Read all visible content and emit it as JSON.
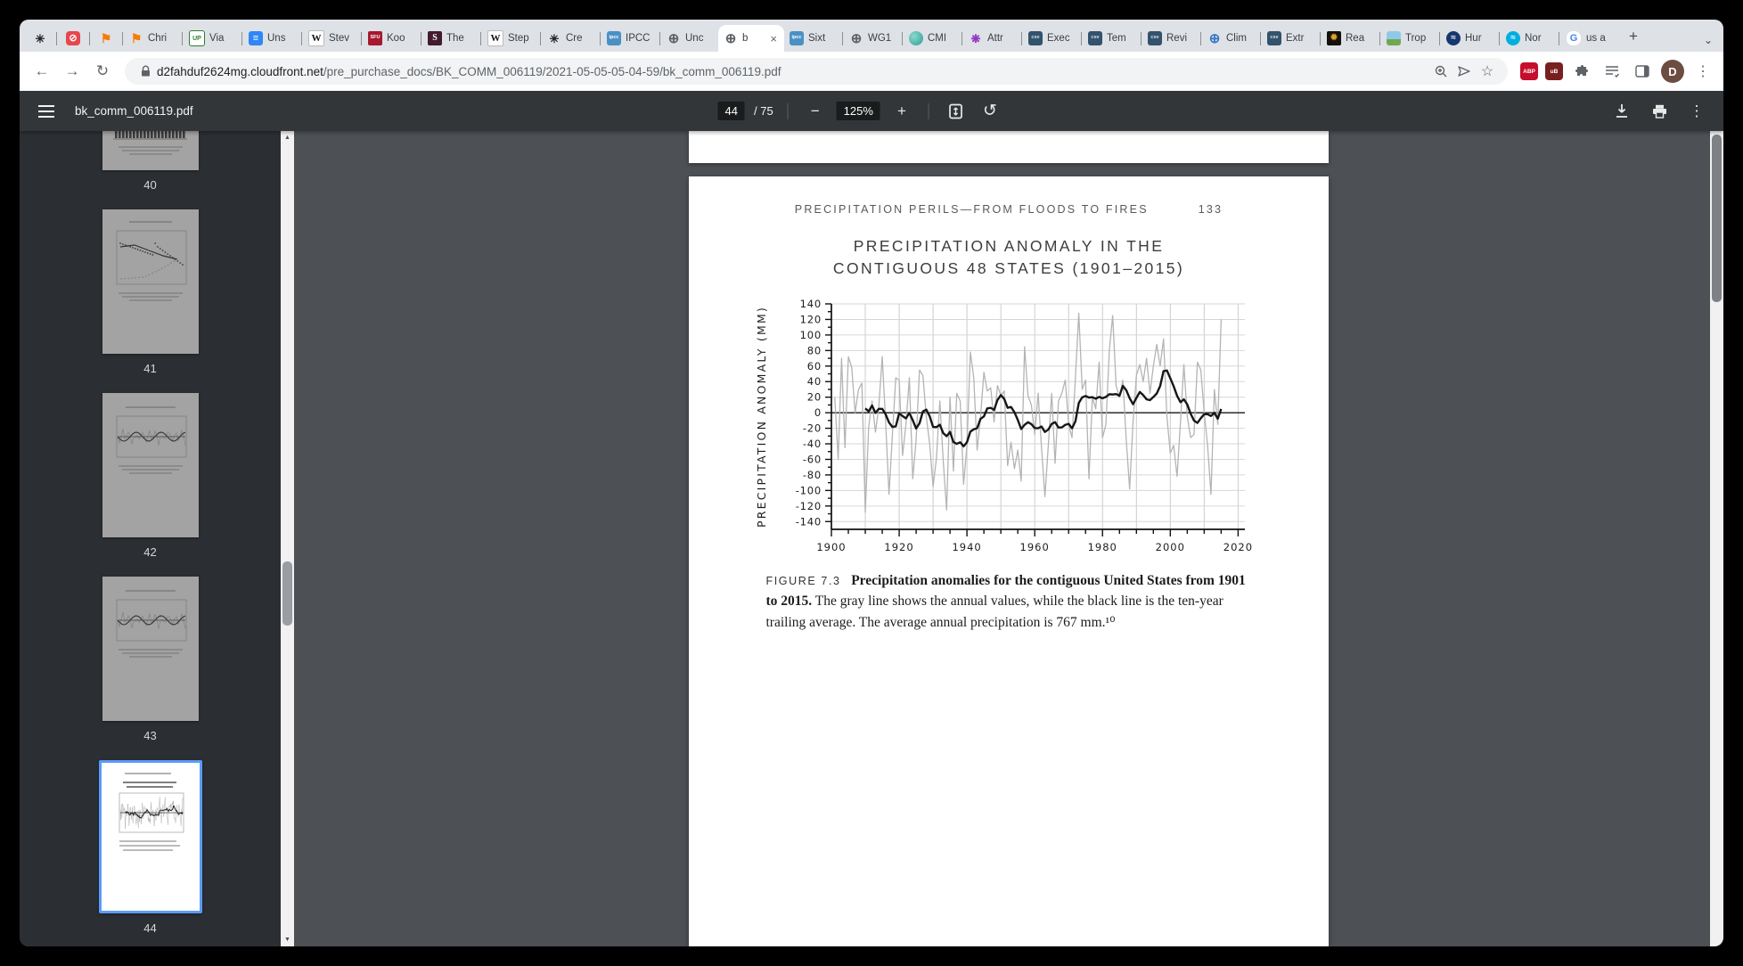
{
  "colors": {
    "accent_blue": "#5b9bf8",
    "pdf_toolbar": "#323639",
    "content_bg": "#4d5155",
    "tabstrip_bg": "#dee1e6"
  },
  "browser": {
    "tabs": {
      "pinned": [
        {
          "icon": "starburst-dark"
        },
        {
          "icon": "shield-red"
        },
        {
          "icon": "bookmark-orange"
        }
      ],
      "items": [
        {
          "icon": "bookmark-orange",
          "label": "Chri"
        },
        {
          "icon": "up-green",
          "label": "Via"
        },
        {
          "icon": "docs-blue",
          "label": "Uns"
        },
        {
          "icon": "wikipedia",
          "label": "Stev"
        },
        {
          "icon": "sfu-red",
          "label": "Koo"
        },
        {
          "icon": "s-dark",
          "label": "The"
        },
        {
          "icon": "wikipedia",
          "label": "Step"
        },
        {
          "icon": "starburst-dark",
          "label": "Cre"
        },
        {
          "icon": "ipcc-blue",
          "label": "IPCC"
        },
        {
          "icon": "globe-gray",
          "label": "Unc"
        },
        {
          "icon": "globe-gray",
          "label": "b",
          "active": true,
          "close": "×"
        },
        {
          "icon": "ipcc-blue",
          "label": "Sixt"
        },
        {
          "icon": "globe-gray",
          "label": "WG1"
        },
        {
          "icon": "sphere-teal",
          "label": "CMI"
        },
        {
          "icon": "starburst-purple",
          "label": "Attr"
        },
        {
          "icon": "doc-slate",
          "label": "Exec"
        },
        {
          "icon": "doc-slate",
          "label": "Tem"
        },
        {
          "icon": "doc-slate",
          "label": "Revi"
        },
        {
          "icon": "globe-blue",
          "label": "Clim"
        },
        {
          "icon": "doc-slate",
          "label": "Extr"
        },
        {
          "icon": "ornament-gold",
          "label": "Rea"
        },
        {
          "icon": "landscape",
          "label": "Trop"
        },
        {
          "icon": "noaa-navy",
          "label": "Hur"
        },
        {
          "icon": "noaa-cyan",
          "label": "Nor"
        },
        {
          "icon": "google-g",
          "label": "us a"
        }
      ],
      "new_tab_label": "+",
      "chevron": "⌄"
    },
    "address_bar": {
      "url_domain": "d2fahduf2624mg.cloudfront.net",
      "url_path": "/pre_purchase_docs/BK_COMM_006119/2021-05-05-05-04-59/bk_comm_006119.pdf",
      "bookmark_star": "☆",
      "avatar_letter": "D",
      "abp_label": "ABP",
      "ublock_label": "uB",
      "menu_glyph": "⋮",
      "back_glyph": "←",
      "forward_glyph": "→",
      "reload_glyph": "↻"
    }
  },
  "pdf_viewer": {
    "toolbar": {
      "filename": "bk_comm_006119.pdf",
      "page_current": "44",
      "page_total_label": "/ 75",
      "minus_glyph": "−",
      "zoom_level": "125%",
      "plus_glyph": "+",
      "rotate_glyph": "↺",
      "menu_glyph": "⋮"
    },
    "sidebar": {
      "pages": [
        {
          "label": "40",
          "sketch": "bars",
          "clip": -118
        },
        {
          "label": "41",
          "sketch": "scatter",
          "clip": 0
        },
        {
          "label": "42",
          "sketch": "line",
          "clip": 0
        },
        {
          "label": "43",
          "sketch": "line",
          "clip": 0
        },
        {
          "label": "44",
          "sketch": "page44",
          "clip": 0,
          "active": true
        }
      ]
    }
  },
  "document_page": {
    "running_header": "PRECIPITATION PERILS—FROM FLOODS TO FIRES",
    "page_number": "133",
    "title_line1": "PRECIPITATION ANOMALY IN THE",
    "title_line2": "CONTIGUOUS 48 STATES (1901–2015)",
    "caption": {
      "label": "FIGURE 7.3",
      "bold": "Precipitation anomalies for the contiguous United States from 1901 to 2015.",
      "text": "The gray line shows the annual values, while the black line is the ten-year trailing average. The average annual precipitation is 767 mm.¹⁰"
    }
  },
  "chart_data": {
    "type": "line",
    "title": "Precipitation anomaly in the contiguous 48 states (1901–2015)",
    "xlabel": "",
    "ylabel": "Precipitation Anomaly (mm)",
    "xlim": [
      1900,
      2022
    ],
    "ylim": [
      -140,
      140
    ],
    "x_tick_label_step": 20,
    "x_minor_tick_step": 5,
    "y_tick_label_step": 20,
    "y_minor_tick_step": 10,
    "grid": {
      "vertical_every_years": 10,
      "horizontal_every_mm": 20,
      "zero_line": true
    },
    "legend_position": "none (described in caption)",
    "x_start": 1901,
    "x_step": 1,
    "series": [
      {
        "name": "Annual values",
        "color": "#b4b4b4",
        "values": [
          20,
          -60,
          70,
          -45,
          72,
          58,
          0,
          30,
          38,
          -128,
          -18,
          15,
          -25,
          8,
          72,
          -12,
          -105,
          -28,
          45,
          42,
          -55,
          -15,
          45,
          -85,
          -35,
          55,
          48,
          -5,
          -40,
          -95,
          -58,
          15,
          -62,
          -125,
          20,
          -75,
          25,
          15,
          -92,
          -42,
          78,
          45,
          -48,
          -5,
          52,
          28,
          32,
          -12,
          35,
          22,
          28,
          -68,
          -38,
          -72,
          -48,
          -88,
          85,
          22,
          10,
          -28,
          25,
          -45,
          -108,
          -42,
          25,
          -65,
          15,
          25,
          42,
          -15,
          -32,
          45,
          128,
          30,
          42,
          -85,
          20,
          5,
          65,
          -32,
          -15,
          80,
          125,
          35,
          20,
          42,
          -35,
          -98,
          -12,
          48,
          62,
          40,
          70,
          25,
          60,
          88,
          60,
          95,
          -5,
          -52,
          -42,
          -82,
          -12,
          62,
          -5,
          -32,
          -28,
          65,
          55,
          0,
          -42,
          -105,
          30,
          -15,
          120
        ]
      },
      {
        "name": "Ten-year trailing average",
        "color": "#161616",
        "derived": "trailing_mean_10"
      }
    ],
    "average_annual_precipitation_mm": 767
  }
}
